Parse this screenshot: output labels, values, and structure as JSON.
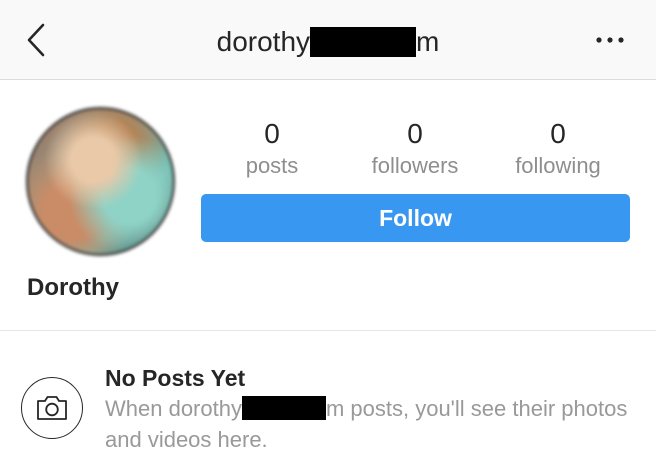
{
  "header": {
    "title_prefix": "dorothy",
    "title_suffix": "m",
    "back_icon": "chevron-left-icon",
    "more_label": "•••",
    "more_icon": "more-horizontal-icon"
  },
  "profile": {
    "display_name": "Dorothy",
    "stats": [
      {
        "value": "0",
        "label": "posts"
      },
      {
        "value": "0",
        "label": "followers"
      },
      {
        "value": "0",
        "label": "following"
      }
    ],
    "follow_label": "Follow"
  },
  "empty_state": {
    "icon": "camera-icon",
    "title": "No Posts Yet",
    "text_prefix": "When dorothy",
    "text_suffix": "m posts, you'll see their photos and videos here."
  },
  "colors": {
    "accent": "#3897f0",
    "text": "#262626",
    "muted": "#8e8e8e",
    "header_bg": "#f9f9f9"
  }
}
